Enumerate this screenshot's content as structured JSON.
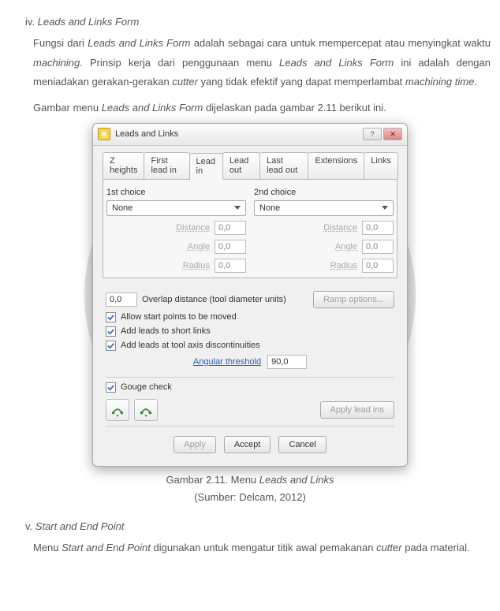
{
  "sections": {
    "iv": {
      "roman": "iv.",
      "title": "Leads and Links Form"
    },
    "v": {
      "roman": "v.",
      "title": "Start and End Point"
    }
  },
  "paragraphs": {
    "p1_a": "Fungsi dari ",
    "p1_b": "Leads and Links Form",
    "p1_c": " adalah sebagai cara untuk mempercepat atau menyingkat waktu ",
    "p1_d": "machining.",
    "p1_e": " Prinsip kerja dari penggunaan menu ",
    "p1_f": "Leads and Links Form",
    "p1_g": " ini adalah dengan meniadakan gerakan-gerakan ",
    "p1_h": "cutter",
    "p1_i": " yang tidak efektif yang dapat memperlambat ",
    "p1_j": "machining time",
    "p1_k": ".",
    "p2_a": "Gambar menu ",
    "p2_b": "Leads and Links Form",
    "p2_c": " dijelaskan pada gambar 2.11 berikut ini.",
    "p3_a": "Menu ",
    "p3_b": "Start and End Point",
    "p3_c": " digunakan untuk mengatur titik awal pemakanan ",
    "p3_d": "cutter",
    "p3_e": " pada material."
  },
  "caption": {
    "line1_a": "Gambar  2.11. Menu ",
    "line1_b": "Leads and Links",
    "line2": "(Sumber: Delcam, 2012)"
  },
  "dialog": {
    "title": "Leads and Links",
    "tabs": [
      "Z heights",
      "First lead in",
      "Lead in",
      "Lead out",
      "Last lead out",
      "Extensions",
      "Links"
    ],
    "activeTab": 2,
    "choice1": {
      "heading": "1st choice",
      "combo": "None",
      "distance_label": "Distance",
      "angle_label": "Angle",
      "radius_label": "Radius",
      "distance": "0,0",
      "angle": "0,0",
      "radius": "0,0"
    },
    "choice2": {
      "heading": "2nd choice",
      "combo": "None",
      "distance_label": "Distance",
      "angle_label": "Angle",
      "radius_label": "Radius",
      "distance": "0,0",
      "angle": "0,0",
      "radius": "0,0"
    },
    "overlap_value": "0,0",
    "overlap_label": "Overlap distance (tool diameter units)",
    "ramp_btn": "Ramp options...",
    "cb1": "Allow start points to be moved",
    "cb2": "Add leads to short links",
    "cb3": "Add leads at tool axis discontinuities",
    "ang_label": "Angular threshold",
    "ang_value": "90,0",
    "cb_gouge": "Gouge check",
    "apply_leadins": "Apply lead ins",
    "btn_apply": "Apply",
    "btn_accept": "Accept",
    "btn_cancel": "Cancel"
  }
}
